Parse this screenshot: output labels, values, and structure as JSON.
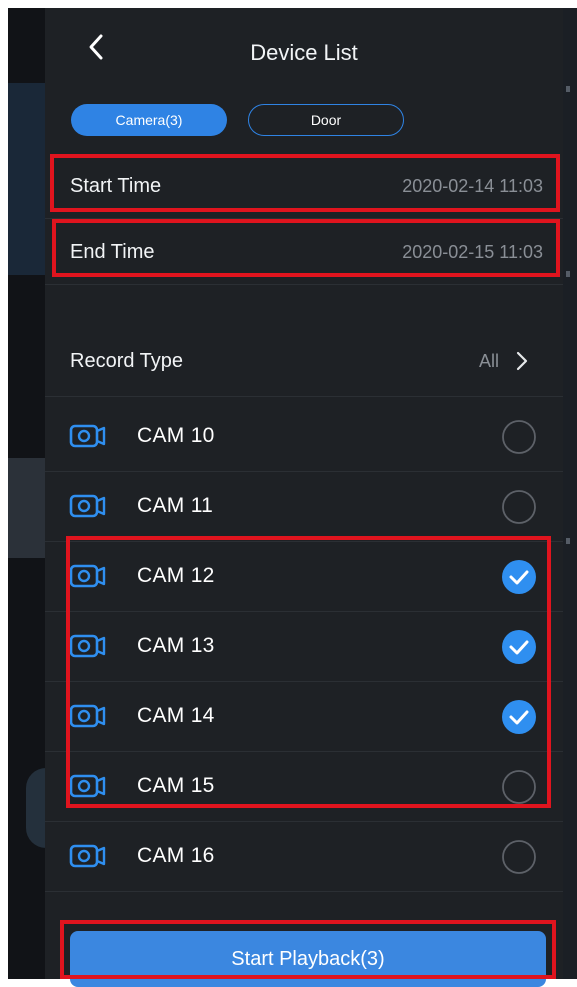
{
  "header": {
    "title": "Device List"
  },
  "tabs": [
    {
      "label": "Camera(3)",
      "active": true
    },
    {
      "label": "Door",
      "active": false
    }
  ],
  "start_time": {
    "label": "Start Time",
    "value": "2020-02-14 11:03"
  },
  "end_time": {
    "label": "End Time",
    "value": "2020-02-15 11:03"
  },
  "record_type": {
    "label": "Record Type",
    "value": "All"
  },
  "cameras": [
    {
      "label": "CAM 10",
      "checked": false
    },
    {
      "label": "CAM 11",
      "checked": false
    },
    {
      "label": "CAM 12",
      "checked": true
    },
    {
      "label": "CAM 13",
      "checked": true
    },
    {
      "label": "CAM 14",
      "checked": true
    },
    {
      "label": "CAM 15",
      "checked": false
    },
    {
      "label": "CAM 16",
      "checked": false
    }
  ],
  "playback_button": {
    "label": "Start Playback(3)"
  },
  "colors": {
    "accent": "#2f83e4",
    "panel": "#1e2125",
    "highlight": "#e0141e",
    "muted_text": "#8a8f96"
  },
  "icons": {
    "back": "chevron-left-icon",
    "record_type_arrow": "chevron-right-icon",
    "camera": "camera-icon",
    "checked": "check-circle-icon",
    "unchecked": "empty-circle-icon"
  }
}
